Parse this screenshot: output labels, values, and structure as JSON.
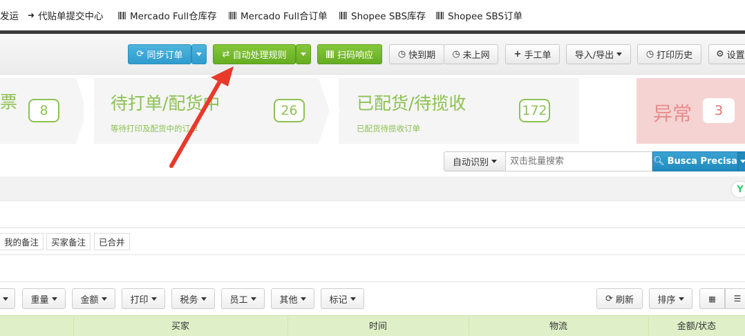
{
  "top_nav": {
    "items": [
      {
        "label": "发运",
        "icon": ""
      },
      {
        "label": "代贴单提交中心",
        "icon": "sign-in-icon"
      },
      {
        "label": "Mercado Full仓库存",
        "icon": "barcode-icon"
      },
      {
        "label": "Mercado Full合订单",
        "icon": "barcode-icon"
      },
      {
        "label": "Shopee SBS库存",
        "icon": "barcode-icon"
      },
      {
        "label": "Shopee SBS订单",
        "icon": "barcode-icon"
      }
    ]
  },
  "toolbar": {
    "sync_orders": "同步订单",
    "auto_rules": "自动处理规则",
    "scan_response": "扫码响应",
    "expiring_soon": "快到期",
    "not_online": "未上网",
    "manual_order": "手工单",
    "import_export": "导入/导出",
    "print_history": "打印历史",
    "settings": "设置"
  },
  "stats": {
    "first": {
      "title": "票",
      "count": "8"
    },
    "second": {
      "title": "待打单/配货中",
      "subtitle": "等待打印及配货中的订单",
      "count": "26"
    },
    "third": {
      "title": "已配货/待揽收",
      "subtitle": "已配货待揽收订单",
      "count": "172"
    },
    "exception": {
      "title": "异常",
      "count": "3"
    }
  },
  "search": {
    "mode": "自动识别",
    "placeholder": "双击批量搜索",
    "button": "Busca Precisa"
  },
  "tags": [
    "我的备注",
    "买家备注",
    "已合并"
  ],
  "filters": {
    "weight": "重量",
    "amount": "金额",
    "print": "打印",
    "tax": "税务",
    "staff": "员工",
    "other": "其他",
    "mark": "标记",
    "refresh": "刷新",
    "sort": "排序"
  },
  "table": {
    "headers": [
      "买家",
      "时间",
      "物流",
      "金额/状态"
    ]
  },
  "colors": {
    "accent_green": "#8cc152",
    "blue_button": "#2f9ccd",
    "green_button": "#66ad22",
    "exception_bg": "#f6d3d3",
    "annotation_arrow": "#e8392b"
  }
}
